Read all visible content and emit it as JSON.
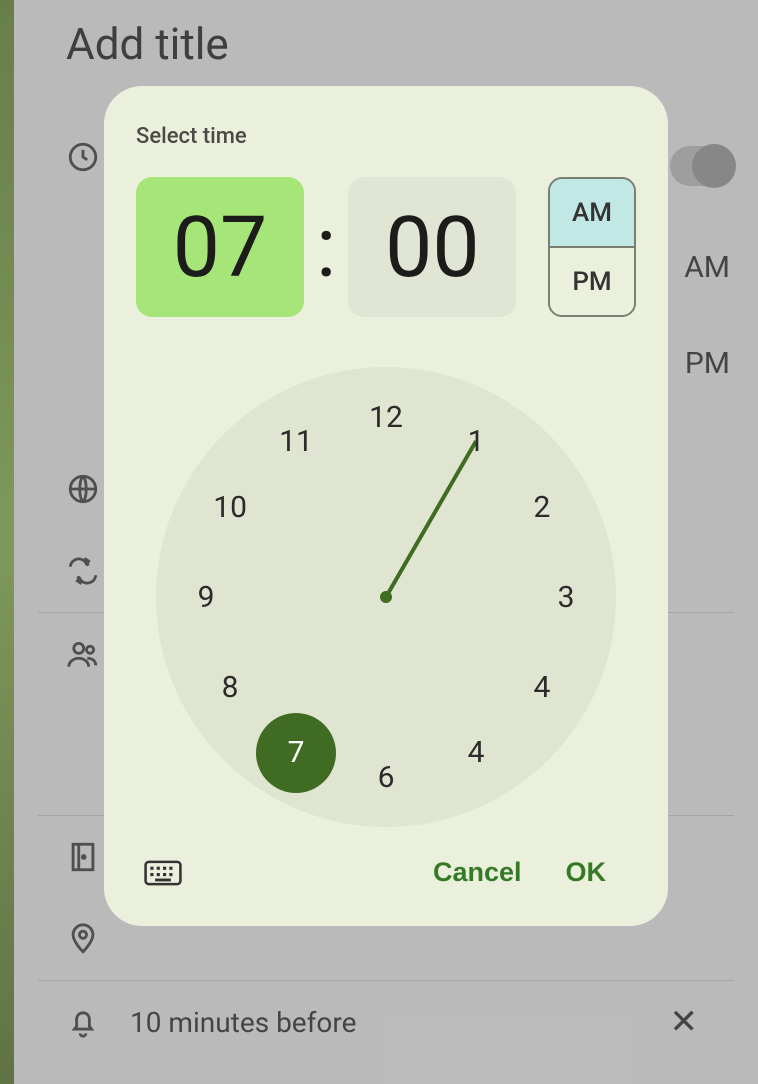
{
  "form": {
    "title": "Add title",
    "time1": "AM",
    "time2": "PM",
    "notification": "10 minutes before"
  },
  "dialog": {
    "title": "Select time",
    "hour": "07",
    "minute": "00",
    "am_label": "AM",
    "pm_label": "PM",
    "selected_period": "AM",
    "selected_hour": 7,
    "clock_numbers": [
      "12",
      "1",
      "2",
      "3",
      "4",
      "4",
      "6",
      "7",
      "8",
      "9",
      "10",
      "11"
    ],
    "cancel": "Cancel",
    "ok": "OK"
  },
  "colors": {
    "dialog_bg": "#ebf0dd",
    "hour_active": "#a6e679",
    "accent": "#3f6b22",
    "am_selected": "#c2e8e6"
  }
}
